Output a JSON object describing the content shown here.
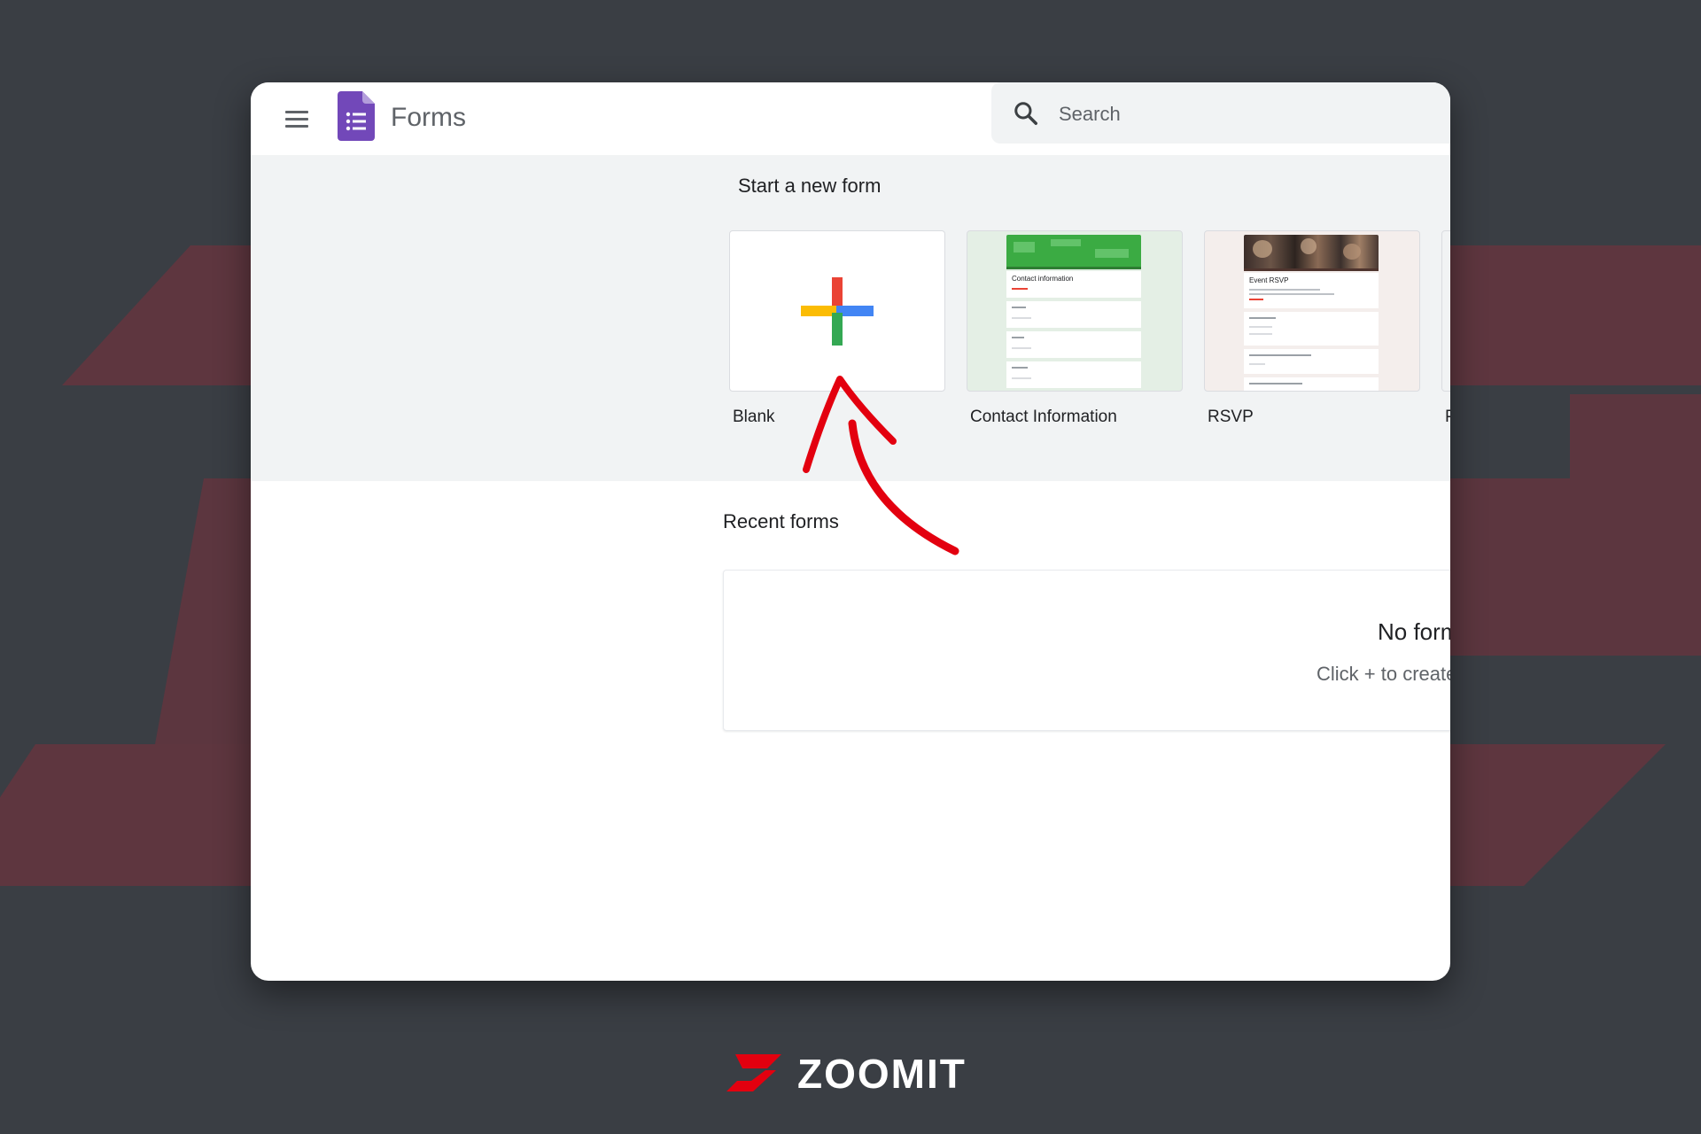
{
  "app": {
    "title": "Forms",
    "logo_icon": "google-forms-icon",
    "menu_icon": "hamburger-icon"
  },
  "search": {
    "placeholder": "Search",
    "value": "",
    "icon": "search-icon"
  },
  "start_section": {
    "heading": "Start a new form",
    "templates": [
      {
        "label": "Blank",
        "icon": "plus-icon"
      },
      {
        "label": "Contact Information",
        "thumb_title": "Contact information"
      },
      {
        "label": "RSVP",
        "thumb_title": "Event RSVP"
      },
      {
        "label": "P"
      }
    ]
  },
  "recent_section": {
    "heading": "Recent forms",
    "empty_title": "No form",
    "empty_subtitle": "Click + to create"
  },
  "annotation": {
    "type": "red-arrow",
    "points_to": "Blank"
  },
  "watermark": {
    "brand": "ZOOMIT"
  },
  "colors": {
    "forms_purple": "#7248b9",
    "google_red": "#ea4335",
    "google_blue": "#4285f4",
    "google_yellow": "#fbbc04",
    "google_green": "#34a853",
    "arrow_red": "#e3000f",
    "background": "#3a3e44"
  }
}
